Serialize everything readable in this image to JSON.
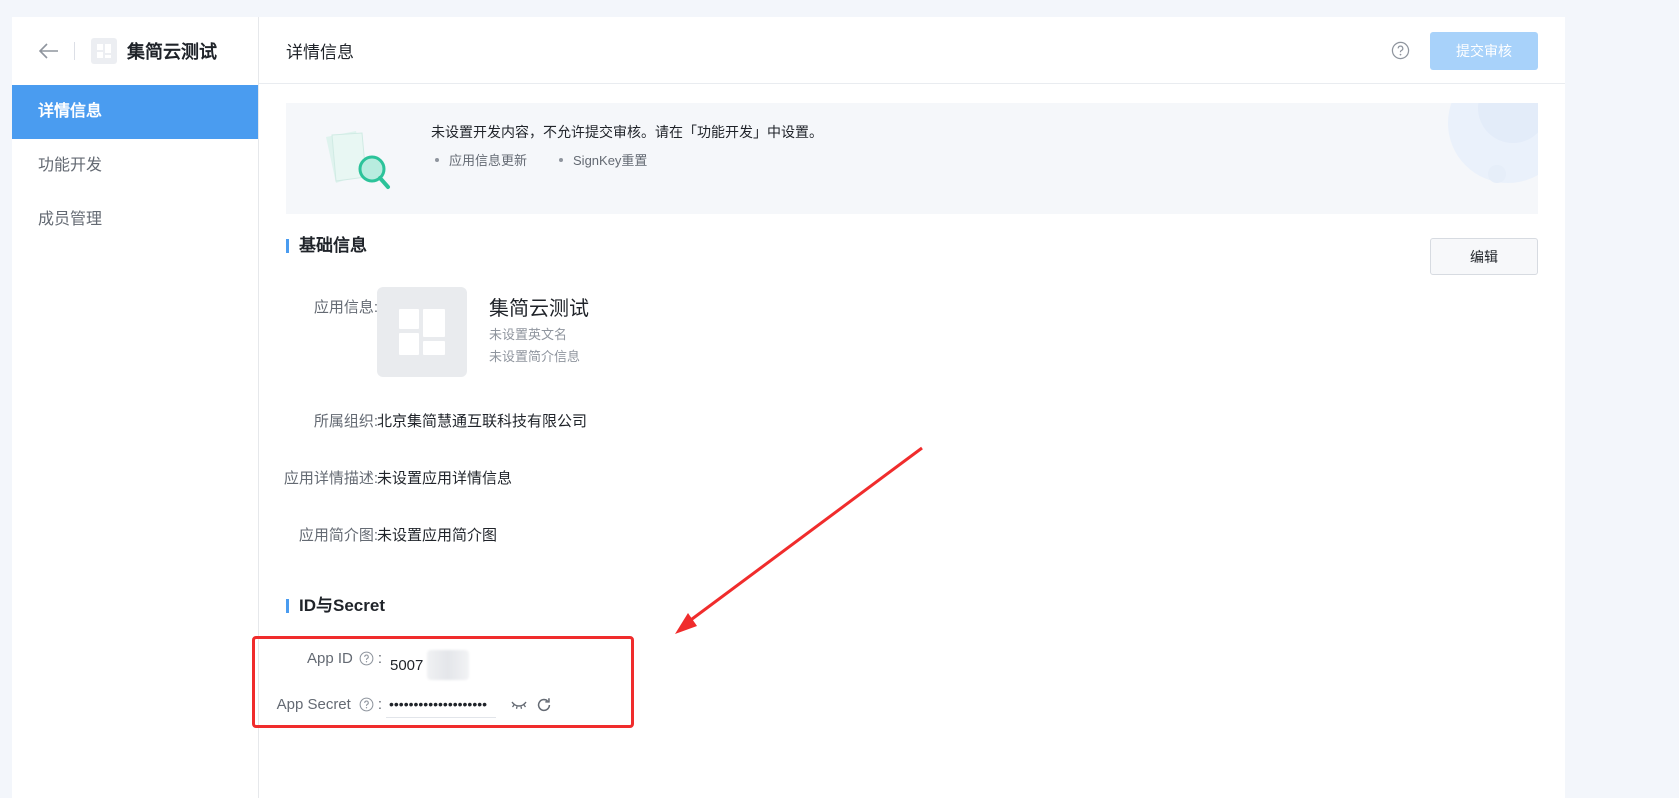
{
  "sidebar": {
    "app_name": "集简云测试",
    "items": [
      {
        "label": "详情信息",
        "active": true
      },
      {
        "label": "功能开发",
        "active": false
      },
      {
        "label": "成员管理",
        "active": false
      }
    ]
  },
  "header": {
    "title": "详情信息",
    "submit_label": "提交审核"
  },
  "notice": {
    "title": "未设置开发内容，不允许提交审核。请在「功能开发」中设置。",
    "items": [
      "应用信息更新",
      "SignKey重置"
    ]
  },
  "basic": {
    "section_title": "基础信息",
    "edit_label": "编辑",
    "app_info_label": "应用信息:",
    "app_title": "集简云测试",
    "english_name": "未设置英文名",
    "intro": "未设置简介信息",
    "org_label": "所属组织:",
    "org_value": "北京集简慧通互联科技有限公司",
    "desc_label": "应用详情描述:",
    "desc_value": "未设置应用详情信息",
    "image_label": "应用简介图:",
    "image_value": "未设置应用简介图"
  },
  "credentials": {
    "section_title": "ID与Secret",
    "app_id_label": "App ID",
    "app_id_value": "5007",
    "app_secret_label": "App Secret",
    "app_secret_value": "••••••••••••••••••••",
    "colon": ":"
  },
  "colors": {
    "accent": "#4a9cf0",
    "submit_disabled": "#a8d2fa",
    "annotation_red": "#f02c2c"
  }
}
